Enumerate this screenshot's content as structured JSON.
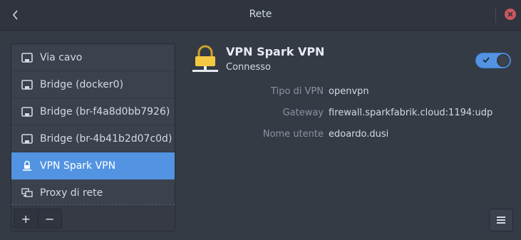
{
  "window": {
    "title": "Rete"
  },
  "sidebar": {
    "items": [
      {
        "label": "Via cavo",
        "icon": "ethernet-icon",
        "selected": false
      },
      {
        "label": "Bridge (docker0)",
        "icon": "ethernet-icon",
        "selected": false
      },
      {
        "label": "Bridge (br-f4a8d0bb7926)",
        "icon": "ethernet-icon",
        "selected": false
      },
      {
        "label": "Bridge (br-4b41b2d07c0d)",
        "icon": "ethernet-icon",
        "selected": false
      },
      {
        "label": "VPN Spark VPN",
        "icon": "vpn-lock-icon",
        "selected": true
      },
      {
        "label": "Proxy di rete",
        "icon": "proxy-icon",
        "selected": false
      }
    ],
    "add_label": "+",
    "remove_label": "−"
  },
  "vpn": {
    "name": "VPN Spark VPN",
    "status": "Connesso",
    "enabled": true,
    "details": [
      {
        "label": "Tipo di VPN",
        "value": "openvpn"
      },
      {
        "label": "Gateway",
        "value": "firewall.sparkfabrik.cloud:1194:udp"
      },
      {
        "label": "Nome utente",
        "value": "edoardo.dusi"
      }
    ]
  },
  "colors": {
    "accent": "#5294e2",
    "close": "#cc575d",
    "lock": "#f4c842"
  }
}
